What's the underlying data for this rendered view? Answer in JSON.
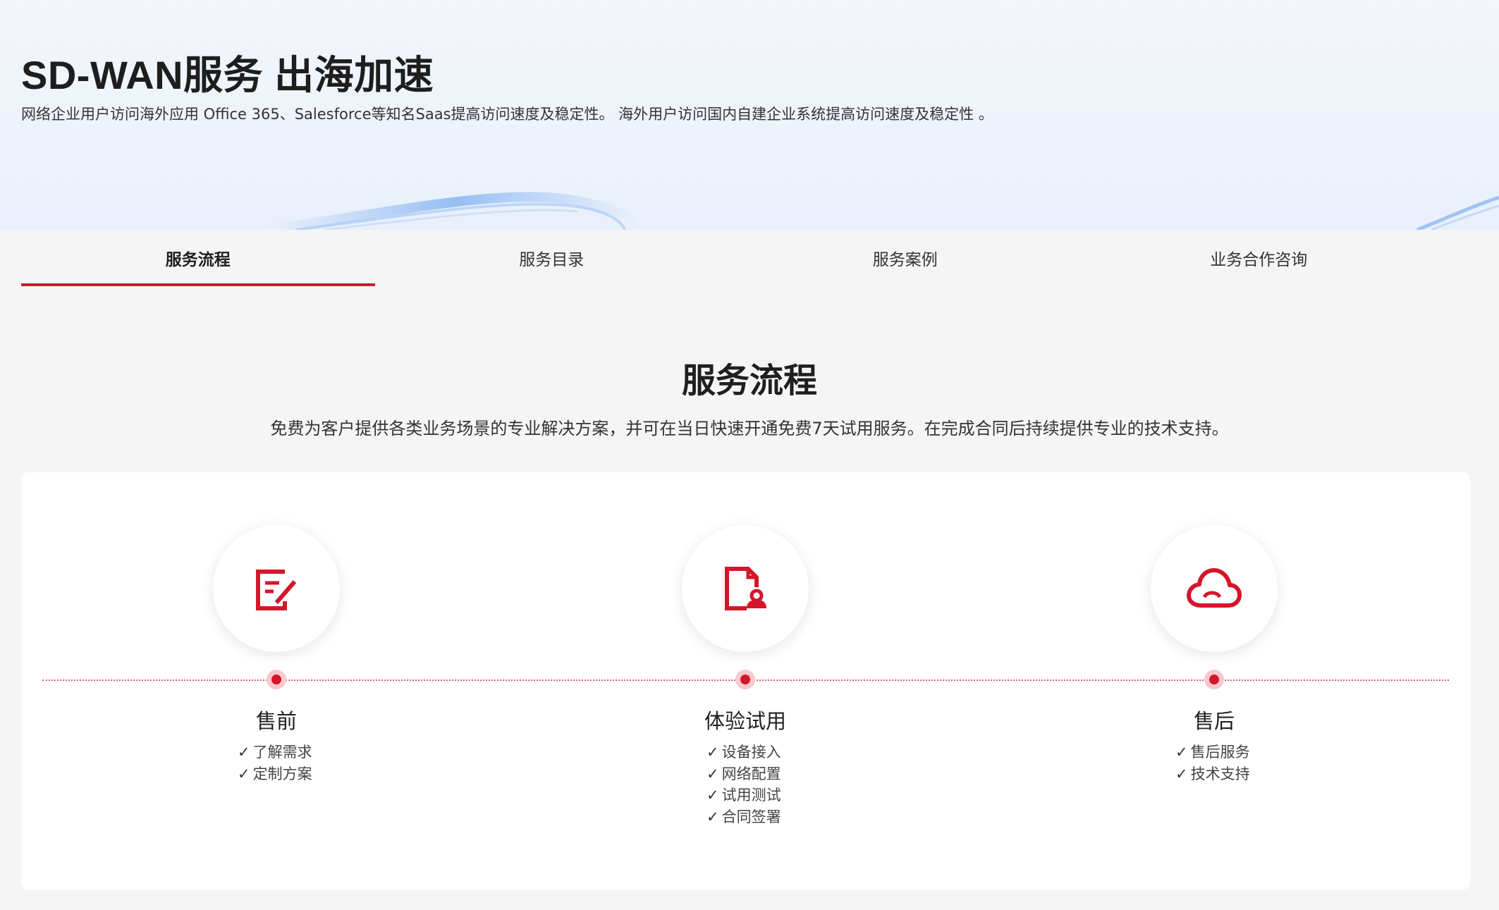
{
  "hero": {
    "title": "SD-WAN服务 出海加速",
    "subtitle": "网络企业用户访问海外应用 Office 365、Salesforce等知名Saas提高访问速度及稳定性。 海外用户访问国内自建企业系统提高访问速度及稳定性 。"
  },
  "tabs": [
    {
      "label": "服务流程",
      "active": true
    },
    {
      "label": "服务目录",
      "active": false
    },
    {
      "label": "服务案例",
      "active": false
    },
    {
      "label": "业务合作咨询",
      "active": false
    }
  ],
  "section": {
    "title": "服务流程",
    "subtitle": "免费为客户提供各类业务场景的专业解决方案，并可在当日快速开通免费7天试用服务。在完成合同后持续提供专业的技术支持。"
  },
  "steps": [
    {
      "title": "售前",
      "icon": "edit-document-icon",
      "items": [
        "了解需求",
        "定制方案"
      ]
    },
    {
      "title": "体验试用",
      "icon": "document-user-icon",
      "items": [
        "设备接入",
        "网络配置",
        "试用测试",
        "合同签署"
      ]
    },
    {
      "title": "售后",
      "icon": "cloud-icon",
      "items": [
        "售后服务",
        "技术支持"
      ]
    }
  ],
  "check_glyph": "✓",
  "colors": {
    "accent": "#d4162a",
    "accent_light": "#f7c9cf",
    "background": "#f5f5f5"
  }
}
